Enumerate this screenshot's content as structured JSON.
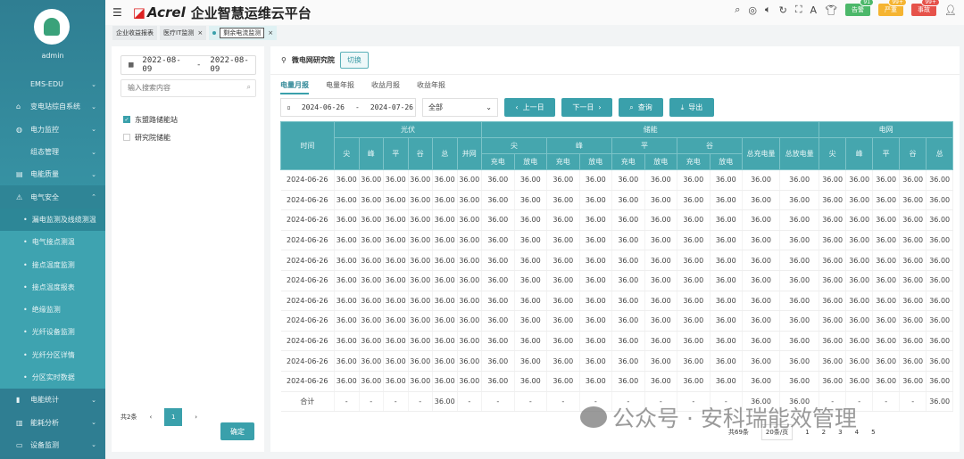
{
  "sidebar": {
    "user": "admin",
    "items": [
      {
        "label": "EMS-EDU",
        "icon": "none"
      },
      {
        "label": "变电站综自系统",
        "icon": "home-icon"
      },
      {
        "label": "电力监控",
        "icon": "globe-icon"
      },
      {
        "label": "组态管理",
        "icon": "none"
      },
      {
        "label": "电能质量",
        "icon": "chart-icon"
      },
      {
        "label": "电气安全",
        "icon": "alarm-icon"
      }
    ],
    "subitems": [
      "漏电监测及线缆测温",
      "电气接点测温",
      "接点温度监测",
      "接点温度报表",
      "绝缘监测",
      "光纤设备监测",
      "光纤分区详情",
      "分区实时数据"
    ],
    "bottom": [
      {
        "label": "电能统计",
        "icon": "bar-icon"
      },
      {
        "label": "能耗分析",
        "icon": "factory-icon"
      },
      {
        "label": "设备监测",
        "icon": "monitor-icon"
      }
    ]
  },
  "header": {
    "brand": "Acrel",
    "title": "企业智慧运维云平台",
    "badges": [
      {
        "label": "告警",
        "count": "91",
        "color": "#4cb86a"
      },
      {
        "label": "严重",
        "count": "99+",
        "color": "#f5b431"
      },
      {
        "label": "事故",
        "count": "99+",
        "color": "#e6524a"
      }
    ]
  },
  "tabs": [
    "企业收益报表",
    "医疗IT监测",
    "剩余电流监测"
  ],
  "left": {
    "date_start": "2022-08-09",
    "date_end": "2022-08-09",
    "search_placeholder": "输入搜索内容",
    "tree": [
      {
        "label": "东盟路储能站",
        "checked": true
      },
      {
        "label": "研究院储能",
        "checked": false
      }
    ],
    "total": "共2条",
    "page": "1",
    "confirm": "确定"
  },
  "main": {
    "site": "微电网研究院",
    "switch": "切换",
    "report_tabs": [
      "电量月报",
      "电量年报",
      "收益月报",
      "收益年报"
    ],
    "date_start": "2024-06-26",
    "date_end": "2024-07-26",
    "select": "全部",
    "prev": "上一日",
    "next": "下一日",
    "query": "查询",
    "export": "导出",
    "headers": {
      "time": "时间",
      "pv": "光伏",
      "storage": "储能",
      "grid": "电网",
      "pv_cols": [
        "尖",
        "峰",
        "平",
        "谷",
        "总",
        "并网"
      ],
      "st_groups": [
        "尖",
        "峰",
        "平",
        "谷"
      ],
      "charge": "充电",
      "discharge": "放电",
      "total_charge": "总充电量",
      "total_discharge": "总放电量",
      "grid_cols": [
        "尖",
        "峰",
        "平",
        "谷",
        "总"
      ]
    },
    "rows": [
      {
        "date": "2024-06-26",
        "values": [
          "36.00",
          "36.00",
          "36.00",
          "36.00",
          "36.00",
          "36.00",
          "36.00",
          "36.00",
          "36.00",
          "36.00",
          "36.00",
          "36.00",
          "36.00",
          "36.00",
          "36.00",
          "36.00",
          "36.00",
          "36.00",
          "36.00",
          "36.00",
          "36.00"
        ]
      },
      {
        "date": "2024-06-26",
        "values": [
          "36.00",
          "36.00",
          "36.00",
          "36.00",
          "36.00",
          "36.00",
          "36.00",
          "36.00",
          "36.00",
          "36.00",
          "36.00",
          "36.00",
          "36.00",
          "36.00",
          "36.00",
          "36.00",
          "36.00",
          "36.00",
          "36.00",
          "36.00",
          "36.00"
        ]
      },
      {
        "date": "2024-06-26",
        "values": [
          "36.00",
          "36.00",
          "36.00",
          "36.00",
          "36.00",
          "36.00",
          "36.00",
          "36.00",
          "36.00",
          "36.00",
          "36.00",
          "36.00",
          "36.00",
          "36.00",
          "36.00",
          "36.00",
          "36.00",
          "36.00",
          "36.00",
          "36.00",
          "36.00"
        ]
      },
      {
        "date": "2024-06-26",
        "values": [
          "36.00",
          "36.00",
          "36.00",
          "36.00",
          "36.00",
          "36.00",
          "36.00",
          "36.00",
          "36.00",
          "36.00",
          "36.00",
          "36.00",
          "36.00",
          "36.00",
          "36.00",
          "36.00",
          "36.00",
          "36.00",
          "36.00",
          "36.00",
          "36.00"
        ]
      },
      {
        "date": "2024-06-26",
        "values": [
          "36.00",
          "36.00",
          "36.00",
          "36.00",
          "36.00",
          "36.00",
          "36.00",
          "36.00",
          "36.00",
          "36.00",
          "36.00",
          "36.00",
          "36.00",
          "36.00",
          "36.00",
          "36.00",
          "36.00",
          "36.00",
          "36.00",
          "36.00",
          "36.00"
        ]
      },
      {
        "date": "2024-06-26",
        "values": [
          "36.00",
          "36.00",
          "36.00",
          "36.00",
          "36.00",
          "36.00",
          "36.00",
          "36.00",
          "36.00",
          "36.00",
          "36.00",
          "36.00",
          "36.00",
          "36.00",
          "36.00",
          "36.00",
          "36.00",
          "36.00",
          "36.00",
          "36.00",
          "36.00"
        ]
      },
      {
        "date": "2024-06-26",
        "values": [
          "36.00",
          "36.00",
          "36.00",
          "36.00",
          "36.00",
          "36.00",
          "36.00",
          "36.00",
          "36.00",
          "36.00",
          "36.00",
          "36.00",
          "36.00",
          "36.00",
          "36.00",
          "36.00",
          "36.00",
          "36.00",
          "36.00",
          "36.00",
          "36.00"
        ]
      },
      {
        "date": "2024-06-26",
        "values": [
          "36.00",
          "36.00",
          "36.00",
          "36.00",
          "36.00",
          "36.00",
          "36.00",
          "36.00",
          "36.00",
          "36.00",
          "36.00",
          "36.00",
          "36.00",
          "36.00",
          "36.00",
          "36.00",
          "36.00",
          "36.00",
          "36.00",
          "36.00",
          "36.00"
        ]
      },
      {
        "date": "2024-06-26",
        "values": [
          "36.00",
          "36.00",
          "36.00",
          "36.00",
          "36.00",
          "36.00",
          "36.00",
          "36.00",
          "36.00",
          "36.00",
          "36.00",
          "36.00",
          "36.00",
          "36.00",
          "36.00",
          "36.00",
          "36.00",
          "36.00",
          "36.00",
          "36.00",
          "36.00"
        ]
      },
      {
        "date": "2024-06-26",
        "values": [
          "36.00",
          "36.00",
          "36.00",
          "36.00",
          "36.00",
          "36.00",
          "36.00",
          "36.00",
          "36.00",
          "36.00",
          "36.00",
          "36.00",
          "36.00",
          "36.00",
          "36.00",
          "36.00",
          "36.00",
          "36.00",
          "36.00",
          "36.00",
          "36.00"
        ]
      },
      {
        "date": "2024-06-26",
        "values": [
          "36.00",
          "36.00",
          "36.00",
          "36.00",
          "36.00",
          "36.00",
          "36.00",
          "36.00",
          "36.00",
          "36.00",
          "36.00",
          "36.00",
          "36.00",
          "36.00",
          "36.00",
          "36.00",
          "36.00",
          "36.00",
          "36.00",
          "36.00",
          "36.00"
        ]
      }
    ],
    "total_row": {
      "label": "合计",
      "values": [
        "-",
        "-",
        "-",
        "-",
        "36.00",
        "-",
        "-",
        "-",
        "-",
        "-",
        "-",
        "-",
        "-",
        "-",
        "36.00",
        "36.00",
        "-",
        "-",
        "-",
        "-",
        "36.00"
      ]
    },
    "pager": {
      "total": "共69条",
      "page_size": "20条/页",
      "pages": [
        "1",
        "2",
        "3",
        "4",
        "5"
      ]
    }
  },
  "watermark": "公众号 · 安科瑞能效管理"
}
